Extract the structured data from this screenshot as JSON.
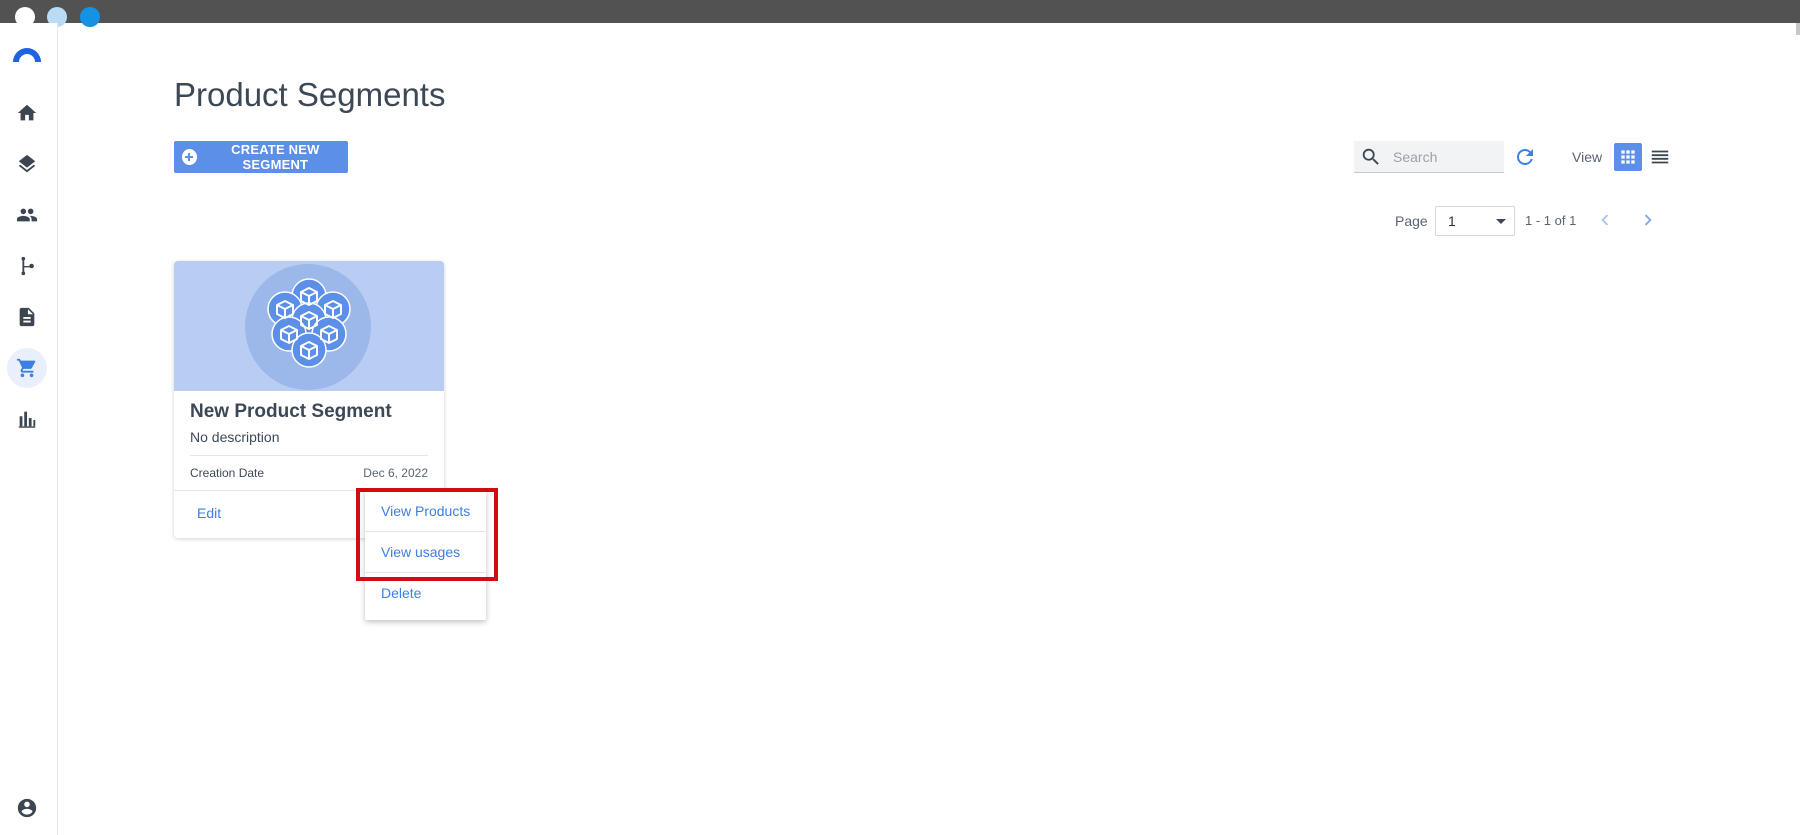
{
  "window": {
    "controls": [
      "close",
      "minimize",
      "maximize"
    ]
  },
  "sidebar": {
    "items": [
      {
        "icon": "home-icon",
        "active": false
      },
      {
        "icon": "layers-icon",
        "active": false
      },
      {
        "icon": "people-icon",
        "active": false
      },
      {
        "icon": "flow-branch-icon",
        "active": false
      },
      {
        "icon": "document-icon",
        "active": false
      },
      {
        "icon": "shopping-cart-icon",
        "active": true
      },
      {
        "icon": "bar-chart-icon",
        "active": false
      }
    ],
    "footer_icon": "account-circle-icon"
  },
  "page": {
    "title": "Product Segments"
  },
  "toolbar": {
    "create_label": "CREATE NEW SEGMENT",
    "search_placeholder": "Search",
    "view_label": "View"
  },
  "pagination": {
    "page_label": "Page",
    "page_value": "1",
    "range_text": "1 - 1 of 1"
  },
  "card": {
    "title": "New Product Segment",
    "description": "No description",
    "meta_label": "Creation Date",
    "meta_value": "Dec 6, 2022",
    "edit_label": "Edit"
  },
  "menu": {
    "items": [
      "View Products",
      "View usages",
      "Delete"
    ]
  },
  "colors": {
    "accent": "#3d7fe2",
    "button": "#5b8fe8",
    "highlight": "#d00d12",
    "titlebar": "#525252"
  }
}
